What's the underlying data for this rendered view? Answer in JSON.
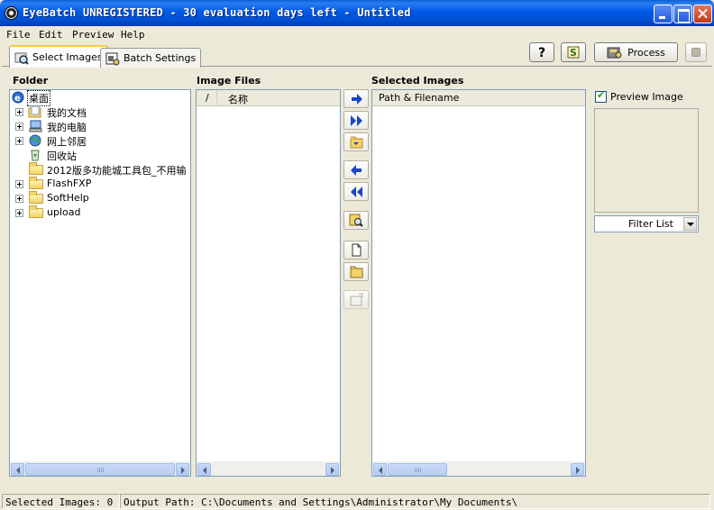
{
  "window": {
    "title": "EyeBatch UNREGISTERED - 30 evaluation days left - Untitled"
  },
  "menu": [
    "File",
    "Edit",
    "Preview",
    "Help"
  ],
  "tabs": [
    {
      "label": "Select Images",
      "icon": "magnifier-image-icon",
      "active": true
    },
    {
      "label": "Batch Settings",
      "icon": "batch-settings-icon",
      "active": false
    }
  ],
  "toolbar": {
    "help_icon": "question-mark-icon",
    "script_icon": "script-icon",
    "process_label": "Process",
    "process_icon": "process-icon",
    "stop_icon": "stop-icon"
  },
  "folder_panel": {
    "header": "Folder",
    "tree": [
      {
        "label": "桌面",
        "icon": "desktop-icon",
        "level": 0,
        "expandable": false,
        "selected": true
      },
      {
        "label": "我的文档",
        "icon": "my-documents-icon",
        "level": 1,
        "expandable": true
      },
      {
        "label": "我的电脑",
        "icon": "my-computer-icon",
        "level": 1,
        "expandable": true
      },
      {
        "label": "网上邻居",
        "icon": "network-icon",
        "level": 1,
        "expandable": true
      },
      {
        "label": "回收站",
        "icon": "recycle-bin-icon",
        "level": 1,
        "expandable": false
      },
      {
        "label": "2012版多功能城工具包_不用输",
        "icon": "folder-icon",
        "level": 1,
        "expandable": false
      },
      {
        "label": "FlashFXP",
        "icon": "folder-icon",
        "level": 1,
        "expandable": true
      },
      {
        "label": "SoftHelp",
        "icon": "folder-icon",
        "level": 1,
        "expandable": true
      },
      {
        "label": "upload",
        "icon": "folder-icon",
        "level": 1,
        "expandable": true
      }
    ]
  },
  "image_files_panel": {
    "header": "Image Files",
    "sort_indicator": "/",
    "column": "名称"
  },
  "selected_images_panel": {
    "header": "Selected Images",
    "column": "Path & Filename"
  },
  "actions": [
    "add-selected-icon",
    "add-all-icon",
    "add-folder-icon",
    "remove-selected-icon",
    "remove-all-icon",
    "find-icon",
    "new-list-icon",
    "open-list-icon",
    "save-list-icon"
  ],
  "preview": {
    "checkbox_label": "Preview Image",
    "checked": true,
    "filter_value": "Filter List"
  },
  "status": {
    "selected_images": "Selected Images: 0",
    "output_path": "Output Path: C:\\Documents and Settings\\Administrator\\My Documents\\"
  }
}
